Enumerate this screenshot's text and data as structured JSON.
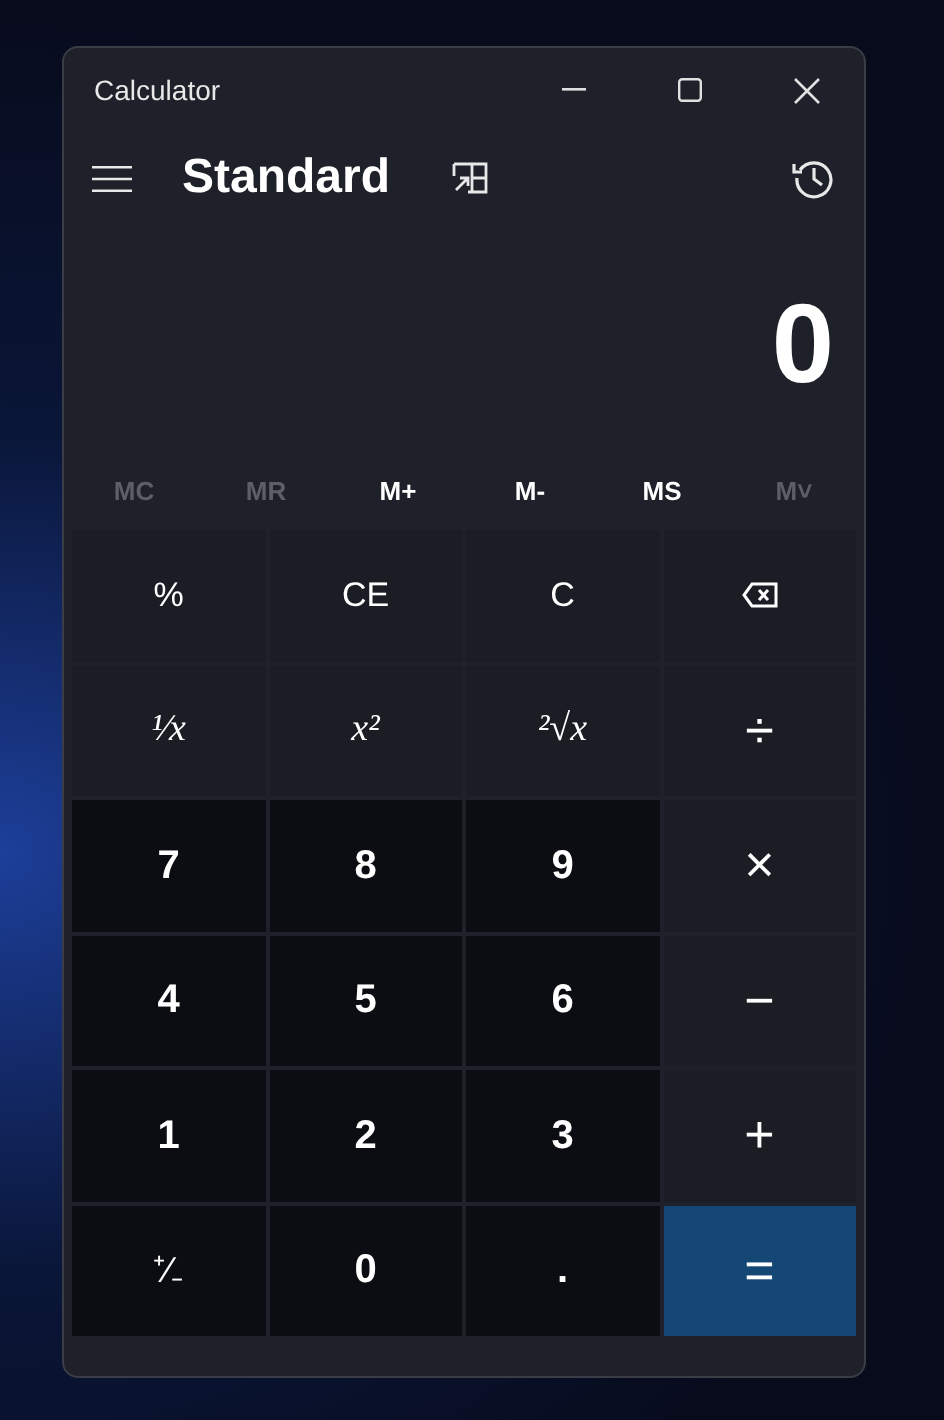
{
  "window": {
    "title": "Calculator"
  },
  "mode": "Standard",
  "display": "0",
  "memory": [
    {
      "label": "MC",
      "disabled": true
    },
    {
      "label": "MR",
      "disabled": true
    },
    {
      "label": "M+",
      "disabled": false
    },
    {
      "label": "M-",
      "disabled": false
    },
    {
      "label": "MS",
      "disabled": false
    },
    {
      "label": "M˅",
      "disabled": true
    }
  ],
  "keys": [
    {
      "kind": "function",
      "label": "%"
    },
    {
      "kind": "function",
      "label": "CE"
    },
    {
      "kind": "function",
      "label": "C"
    },
    {
      "kind": "backspace"
    },
    {
      "kind": "math",
      "label": "¹⁄x"
    },
    {
      "kind": "math",
      "label": "x²"
    },
    {
      "kind": "math",
      "label": "²√x"
    },
    {
      "kind": "operator",
      "label": "÷"
    },
    {
      "kind": "digit",
      "label": "7"
    },
    {
      "kind": "digit",
      "label": "8"
    },
    {
      "kind": "digit",
      "label": "9"
    },
    {
      "kind": "operator",
      "label": "×"
    },
    {
      "kind": "digit",
      "label": "4"
    },
    {
      "kind": "digit",
      "label": "5"
    },
    {
      "kind": "digit",
      "label": "6"
    },
    {
      "kind": "operator",
      "label": "−"
    },
    {
      "kind": "digit",
      "label": "1"
    },
    {
      "kind": "digit",
      "label": "2"
    },
    {
      "kind": "digit",
      "label": "3"
    },
    {
      "kind": "operator",
      "label": "+"
    },
    {
      "kind": "sign",
      "label": "⁺⁄₋"
    },
    {
      "kind": "digit",
      "label": "0"
    },
    {
      "kind": "digit",
      "label": "."
    },
    {
      "kind": "equals",
      "label": "="
    }
  ]
}
